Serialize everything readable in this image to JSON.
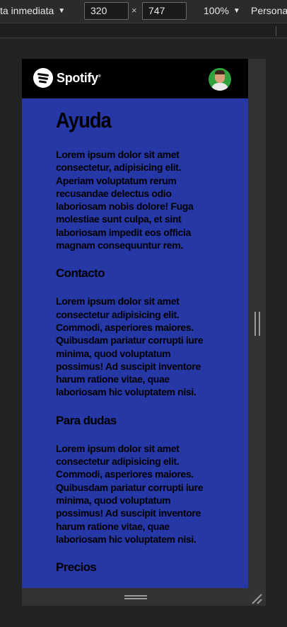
{
  "devtools": {
    "mode_label": "ta inmediata",
    "width_value": "320",
    "height_value": "747",
    "times": "×",
    "zoom_label": "100%",
    "persona_label": "Persona"
  },
  "site": {
    "logo_text": "Spotify",
    "logo_mark": "®"
  },
  "content": {
    "title": "Ayuda",
    "intro": "Lorem ipsum dolor sit amet consectetur, adipisicing elit. Aperiam voluptatum rerum recusandae delectus odio laboriosam nobis dolore! Fuga molestiae sunt culpa, et sint laboriosam impedit eos officia magnam consequuntur rem.",
    "sections": [
      {
        "heading": "Contacto",
        "body": "Lorem ipsum dolor sit amet consectetur adipisicing elit. Commodi, asperiores maiores. Quibusdam pariatur corrupti iure minima, quod voluptatum possimus! Ad suscipit inventore harum ratione vitae, quae laboriosam hic voluptatem nisi."
      },
      {
        "heading": "Para dudas",
        "body": "Lorem ipsum dolor sit amet consectetur adipisicing elit. Commodi, asperiores maiores. Quibusdam pariatur corrupti iure minima, quod voluptatum possimus! Ad suscipit inventore harum ratione vitae, quae laboriosam hic voluptatem nisi."
      },
      {
        "heading": "Precios"
      }
    ]
  },
  "colors": {
    "page_background": "#2637a6",
    "header_background": "#000000",
    "avatar_background": "#2fa43e"
  }
}
